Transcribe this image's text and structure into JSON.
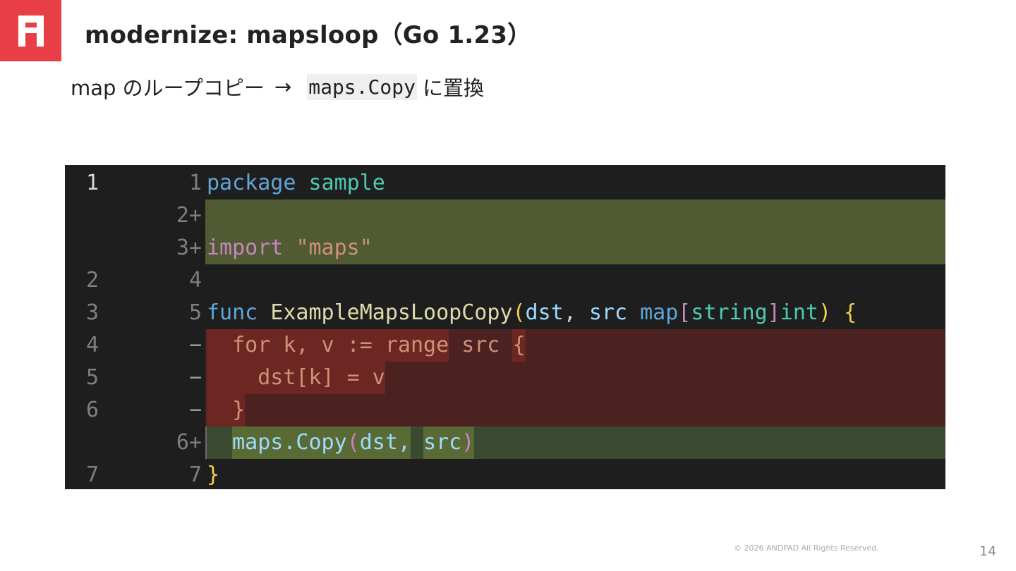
{
  "slide": {
    "title": "modernize: mapsloop（Go 1.23）",
    "subtitle_prefix": "map のループコピー",
    "subtitle_arrow": "→",
    "subtitle_code": "maps.Copy",
    "subtitle_suffix": "に置換",
    "footer": "© 2026 ANDPAD All Rights Reserved.",
    "page_number": "14"
  },
  "colors": {
    "brand": "#e83e46",
    "added_bg": "#505b33",
    "removed_bg": "#4b2220",
    "removed_highlight": "#6d2723"
  },
  "diff": {
    "rows": [
      {
        "old": "1",
        "new": "1",
        "marker": "",
        "type": "context",
        "tokens": [
          {
            "t": "package",
            "c": "kw"
          },
          {
            "t": " ",
            "c": "pl"
          },
          {
            "t": "sample",
            "c": "ty"
          }
        ]
      },
      {
        "old": "",
        "new": "2",
        "marker": "+",
        "type": "add",
        "tokens": []
      },
      {
        "old": "",
        "new": "3",
        "marker": "+",
        "type": "add",
        "tokens": [
          {
            "t": "import",
            "c": "kwp"
          },
          {
            "t": " ",
            "c": "pl"
          },
          {
            "t": "\"maps\"",
            "c": "str"
          }
        ]
      },
      {
        "old": "2",
        "new": "4",
        "marker": "",
        "type": "context",
        "tokens": []
      },
      {
        "old": "3",
        "new": "5",
        "marker": "",
        "type": "context",
        "tokens": [
          {
            "t": "func",
            "c": "kw"
          },
          {
            "t": " ",
            "c": "pl"
          },
          {
            "t": "ExampleMapsLoopCopy",
            "c": "fn"
          },
          {
            "t": "(",
            "c": "br"
          },
          {
            "t": "dst",
            "c": "id"
          },
          {
            "t": ", ",
            "c": "pl"
          },
          {
            "t": "src",
            "c": "id"
          },
          {
            "t": " ",
            "c": "pl"
          },
          {
            "t": "map",
            "c": "kw"
          },
          {
            "t": "[",
            "c": "br2"
          },
          {
            "t": "string",
            "c": "ty"
          },
          {
            "t": "]",
            "c": "br2"
          },
          {
            "t": "int",
            "c": "ty"
          },
          {
            "t": ")",
            "c": "br"
          },
          {
            "t": " ",
            "c": "pl"
          },
          {
            "t": "{",
            "c": "br"
          }
        ]
      },
      {
        "old": "4",
        "new": "",
        "marker": "−",
        "type": "del",
        "tokens": [
          {
            "t": "  ",
            "c": "pl",
            "h": "hl-del"
          },
          {
            "t": "for k, v := range",
            "c": "str",
            "h": "hl-del"
          },
          {
            "t": " src ",
            "c": "str"
          },
          {
            "t": "{",
            "c": "str",
            "h": "hl-del"
          }
        ]
      },
      {
        "old": "5",
        "new": "",
        "marker": "−",
        "type": "del",
        "tokens": [
          {
            "t": "    dst[k] = v",
            "c": "str",
            "h": "hl-del"
          }
        ]
      },
      {
        "old": "6",
        "new": "",
        "marker": "−",
        "type": "del",
        "tokens": [
          {
            "t": "  }",
            "c": "str",
            "h": "hl-del"
          }
        ]
      },
      {
        "old": "",
        "new": "6",
        "marker": "+",
        "type": "add-soft",
        "tokens": [
          {
            "t": "  ",
            "c": "pl"
          },
          {
            "t": "maps.Copy",
            "c": "id",
            "h": "hl-add"
          },
          {
            "t": "(",
            "c": "br2",
            "h": "hl-add"
          },
          {
            "t": "dst,",
            "c": "id",
            "h": "hl-add"
          },
          {
            "t": " ",
            "c": "pl"
          },
          {
            "t": "src",
            "c": "id",
            "h": "hl-add"
          },
          {
            "t": ")",
            "c": "br2",
            "h": "hl-add"
          }
        ]
      },
      {
        "old": "7",
        "new": "7",
        "marker": "",
        "type": "context",
        "tokens": [
          {
            "t": "}",
            "c": "br"
          }
        ]
      }
    ]
  }
}
